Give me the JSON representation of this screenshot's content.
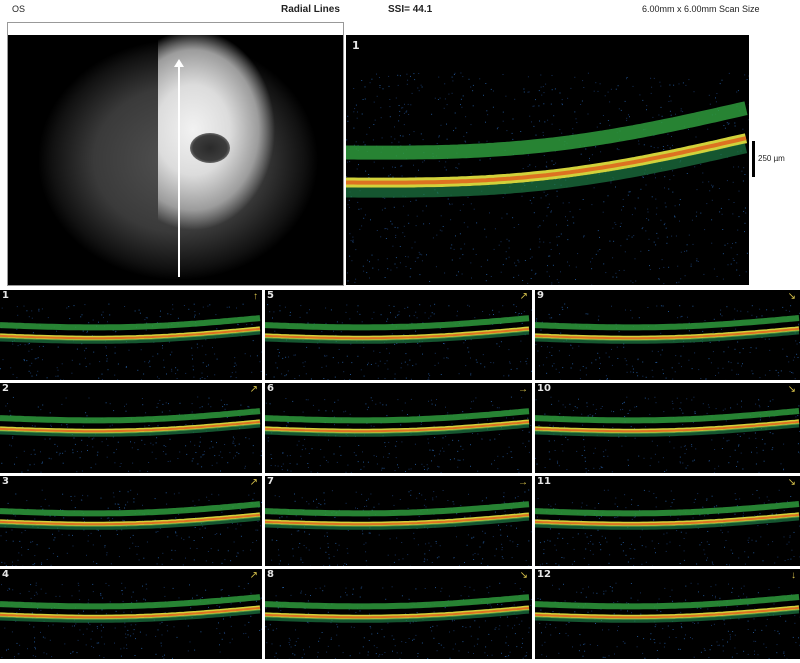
{
  "header": {
    "eye": "OS",
    "mode": "Radial Lines",
    "ssi": "SSI= 44.1",
    "scan_size": "6.00mm x 6.00mm Scan Size"
  },
  "main_scan": {
    "number": "1"
  },
  "scale": {
    "label": "250 µm"
  },
  "scans": [
    {
      "number": "1",
      "arrow": "↑"
    },
    {
      "number": "2",
      "arrow": "↗"
    },
    {
      "number": "3",
      "arrow": "↗"
    },
    {
      "number": "4",
      "arrow": "↗"
    },
    {
      "number": "5",
      "arrow": "↗"
    },
    {
      "number": "6",
      "arrow": "→"
    },
    {
      "number": "7",
      "arrow": "→"
    },
    {
      "number": "8",
      "arrow": "↘"
    },
    {
      "number": "9",
      "arrow": "↘"
    },
    {
      "number": "10",
      "arrow": "↘"
    },
    {
      "number": "11",
      "arrow": "↘"
    },
    {
      "number": "12",
      "arrow": "↓"
    }
  ]
}
